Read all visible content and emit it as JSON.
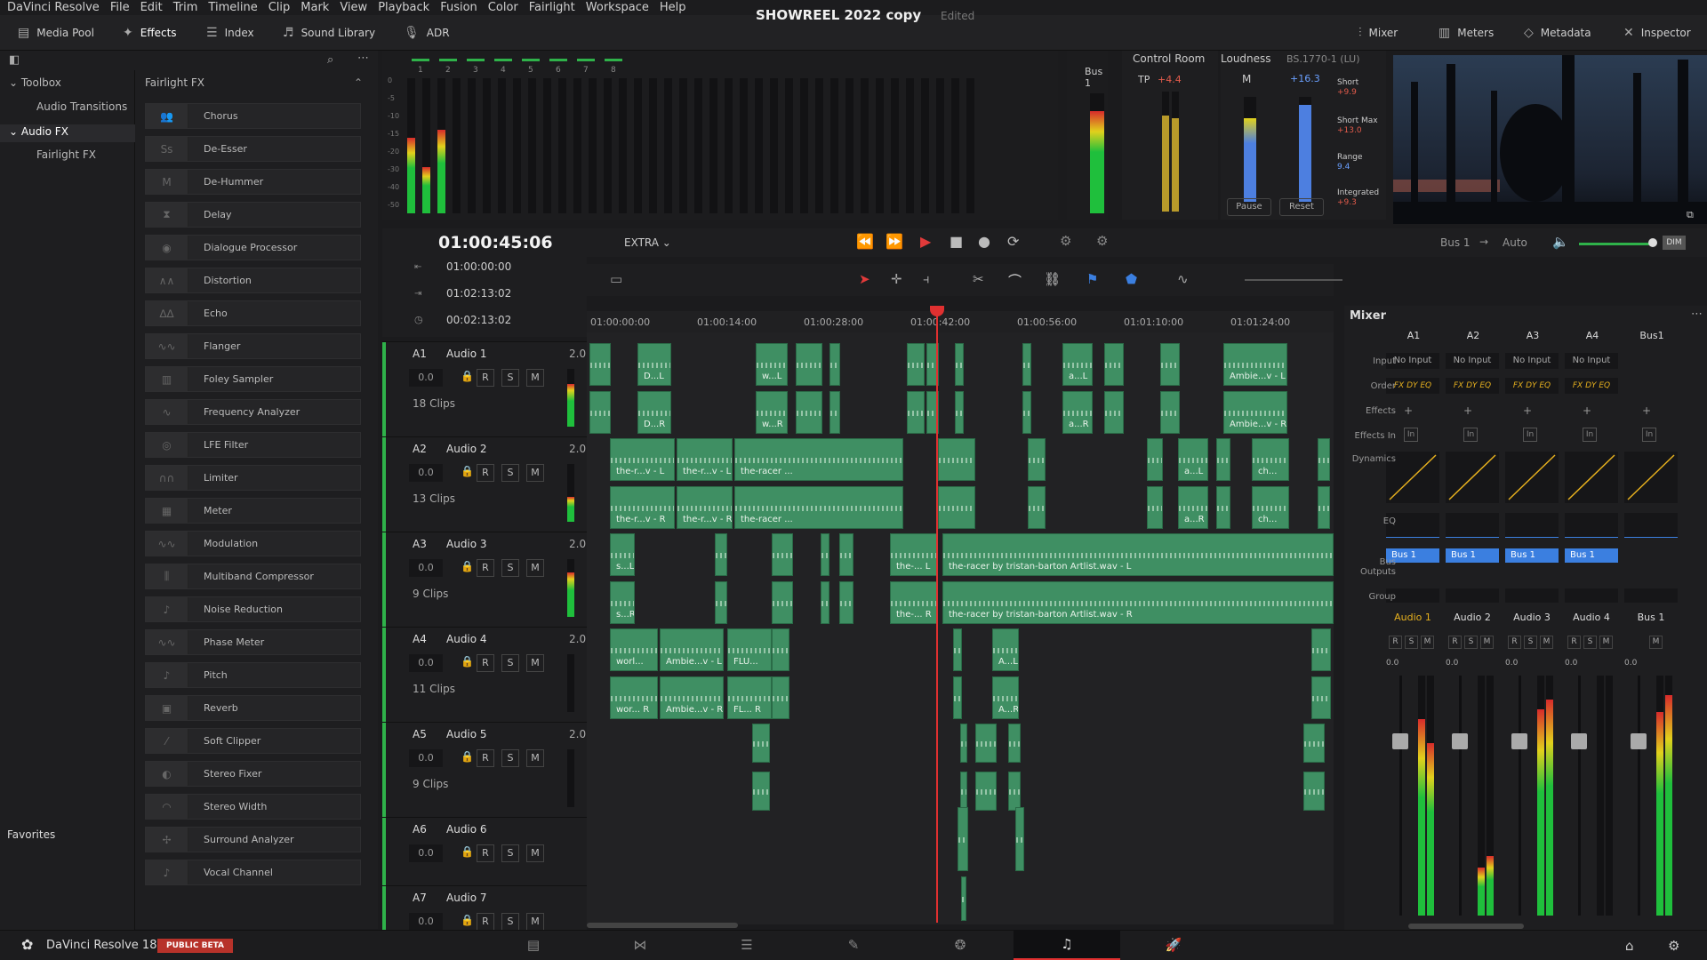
{
  "menu": [
    "DaVinci Resolve",
    "File",
    "Edit",
    "Trim",
    "Timeline",
    "Clip",
    "Mark",
    "View",
    "Playback",
    "Fusion",
    "Color",
    "Fairlight",
    "Workspace",
    "Help"
  ],
  "toolbar": {
    "media_pool": "Media Pool",
    "effects": "Effects",
    "index": "Index",
    "sound_library": "Sound Library",
    "adr": "ADR",
    "mixer": "Mixer",
    "meters": "Meters",
    "metadata": "Metadata",
    "inspector": "Inspector"
  },
  "project": {
    "title": "SHOWREEL  2022 copy",
    "status": "Edited"
  },
  "toolbox": {
    "title": "Toolbox",
    "audio_transitions": "Audio Transitions",
    "audio_fx": "Audio FX",
    "fairlight_fx": "Fairlight FX",
    "favorites": "Favorites"
  },
  "fx_panel": {
    "title": "Fairlight FX",
    "items": [
      "Chorus",
      "De-Esser",
      "De-Hummer",
      "Delay",
      "Dialogue Processor",
      "Distortion",
      "Echo",
      "Flanger",
      "Foley Sampler",
      "Frequency Analyzer",
      "LFE Filter",
      "Limiter",
      "Meter",
      "Modulation",
      "Multiband Compressor",
      "Noise Reduction",
      "Phase Meter",
      "Pitch",
      "Reverb",
      "Soft Clipper",
      "Stereo Fixer",
      "Stereo Width",
      "Surround Analyzer",
      "Vocal Channel"
    ]
  },
  "meters": {
    "channels": [
      "1",
      "2",
      "3",
      "4",
      "5",
      "6",
      "7",
      "8"
    ],
    "scale": [
      "0",
      "-5",
      "-10",
      "-15",
      "-20",
      "-30",
      "-40",
      "-50"
    ],
    "bus": "Bus 1"
  },
  "control_room": {
    "title": "Control Room",
    "tp_label": "TP",
    "tp_value": "+4.4"
  },
  "loudness": {
    "title": "Loudness",
    "standard": "BS.1770-1 (LU)",
    "m_label": "M",
    "m_value": "+16.3",
    "short": "Short",
    "short_v": "+9.9",
    "short_max": "Short Max",
    "short_max_v": "+13.0",
    "range": "Range",
    "range_v": "9.4",
    "integrated": "Integrated",
    "integrated_v": "+9.3",
    "pause": "Pause",
    "reset": "Reset"
  },
  "transport": {
    "timecode": "01:00:45:06",
    "mode": "EXTRA",
    "bus": "Bus 1",
    "auto": "Auto",
    "dim": "DIM"
  },
  "timecodes": {
    "in": "01:00:00:00",
    "out": "01:02:13:02",
    "dur": "00:02:13:02"
  },
  "ruler": [
    "01:00:00:00",
    "01:00:14:00",
    "01:00:28:00",
    "01:00:42:00",
    "01:00:56:00",
    "01:01:10:00",
    "01:01:24:00"
  ],
  "tracks": [
    {
      "id": "A1",
      "name": "Audio 1",
      "ch": "2.0",
      "vol": "0.0",
      "clips": "18 Clips"
    },
    {
      "id": "A2",
      "name": "Audio 2",
      "ch": "2.0",
      "vol": "0.0",
      "clips": "13 Clips"
    },
    {
      "id": "A3",
      "name": "Audio 3",
      "ch": "2.0",
      "vol": "0.0",
      "clips": "9 Clips"
    },
    {
      "id": "A4",
      "name": "Audio 4",
      "ch": "2.0",
      "vol": "0.0",
      "clips": "11 Clips"
    },
    {
      "id": "A5",
      "name": "Audio 5",
      "ch": "2.0",
      "vol": "0.0",
      "clips": "9 Clips"
    },
    {
      "id": "A6",
      "name": "Audio 6",
      "ch": "",
      "vol": "0.0",
      "clips": ""
    },
    {
      "id": "A7",
      "name": "Audio 7",
      "ch": "",
      "vol": "0.0",
      "clips": ""
    }
  ],
  "clips": [
    "D...L",
    "D...R",
    "w...L",
    "w...R",
    "a...L",
    "a...R",
    "Ambie...v - L",
    "Ambie...v - R",
    "the-r...v - L",
    "the-r...v - L",
    "the-racer ...",
    "the-r...v - R",
    "the-r...v - R",
    "the-racer ...",
    "a...L",
    "a...R",
    "ch...",
    "ch...",
    "s...L",
    "s...R",
    "the-... L",
    "the-racer by tristan-barton Artlist.wav - L",
    "the-... R",
    "the-racer by tristan-barton Artlist.wav - R",
    "worl...",
    "Ambie...v - L",
    "FLU...",
    "wor... R",
    "Ambie...v - R",
    "FL... R",
    "A...L",
    "A...R"
  ],
  "mixer": {
    "title": "Mixer",
    "cols": [
      "A1",
      "A2",
      "A3",
      "A4",
      "Bus1"
    ],
    "input": "No Input",
    "order": "FX DY EQ",
    "bus_out": "Bus 1",
    "names": [
      "Audio 1",
      "Audio 2",
      "Audio 3",
      "Audio 4",
      "Bus 1"
    ],
    "labels": [
      "Input",
      "Order",
      "Effects",
      "Effects In",
      "Dynamics",
      "EQ",
      "Bus Outputs",
      "Group"
    ],
    "fader_val": "0.0"
  },
  "status": {
    "app": "DaVinci Resolve 18",
    "beta": "PUBLIC BETA"
  }
}
